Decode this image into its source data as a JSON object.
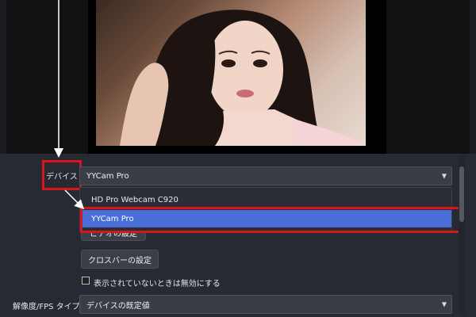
{
  "preview": {
    "description_icon": "webcam-preview"
  },
  "source": {
    "device_label": "デバイス",
    "device_value": "YYCam Pro",
    "dropdown_options": [
      "HD Pro Webcam C920",
      "YYCam Pro"
    ],
    "selected_option": "YYCam Pro",
    "obscured_button_label": "ビデオの設定",
    "crossbar_button_label": "クロスバーの設定",
    "deactivate_checkbox_label": "表示されていないときは無効にする",
    "resolution_label": "解像度/FPS タイプ",
    "resolution_value": "デバイスの既定値"
  },
  "annotation": {
    "highlight_color": "#d9141a",
    "arrow_color": "#ffffff"
  }
}
